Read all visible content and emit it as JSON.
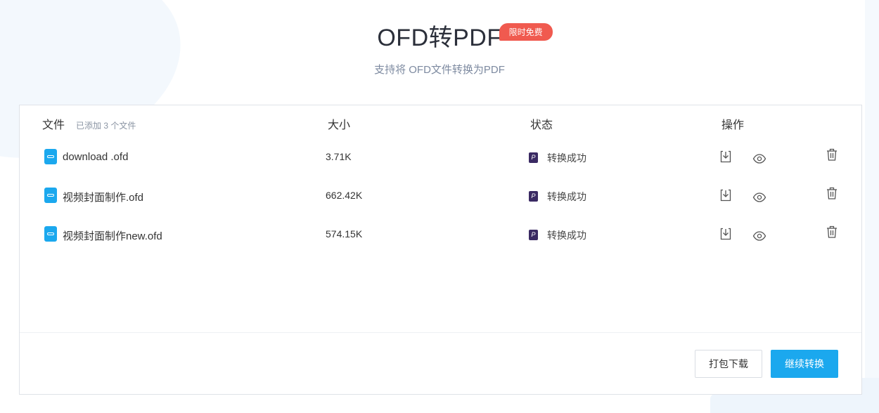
{
  "header": {
    "title": "OFD转PDF",
    "badge": "限时免费",
    "subtitle": "支持将  OFD文件转换为PDF"
  },
  "table": {
    "columns": {
      "file": "文件",
      "file_count": "已添加 3 个文件",
      "size": "大小",
      "status": "状态",
      "actions": "操作"
    },
    "rows": [
      {
        "name": "download .ofd",
        "size": "3.71K",
        "status": "转换成功"
      },
      {
        "name": "视频封面制作.ofd",
        "size": "662.42K",
        "status": "转换成功"
      },
      {
        "name": "视频封面制作new.ofd",
        "size": "574.15K",
        "status": "转换成功"
      }
    ]
  },
  "footer": {
    "pack_download": "打包下载",
    "continue_convert": "继续转换"
  },
  "icons": {
    "file": "ofd-file-icon",
    "status": "pdf-status-icon",
    "download": "download-icon",
    "preview": "eye-icon",
    "delete": "trash-icon"
  },
  "colors": {
    "accent": "#1ba8ee",
    "badge": "#f05a4f",
    "status_icon": "#3a2a63"
  }
}
